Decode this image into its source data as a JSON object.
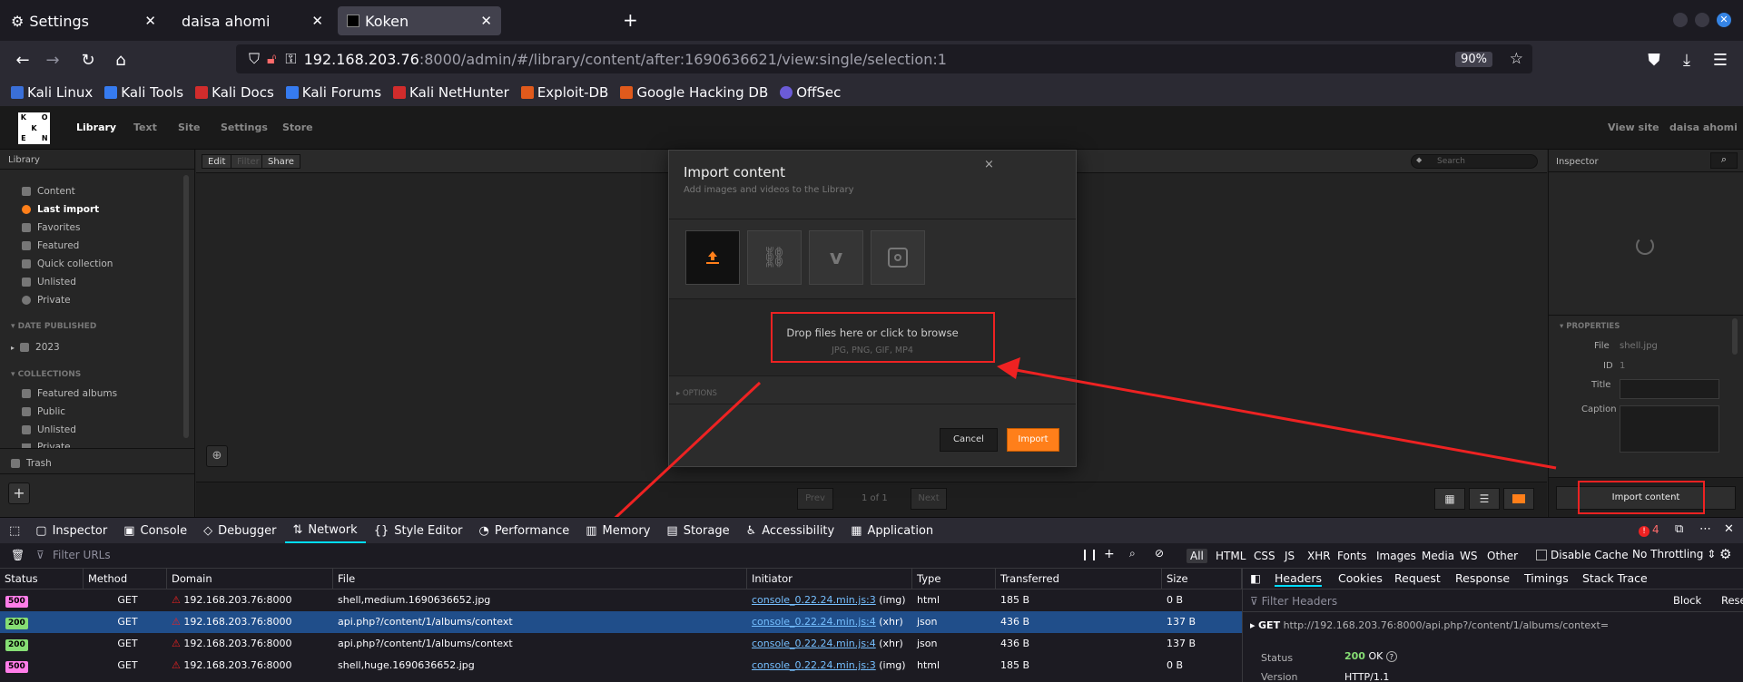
{
  "browser": {
    "tabs": [
      {
        "title": "Settings",
        "active": false
      },
      {
        "title": "daisa ahomi",
        "active": false
      },
      {
        "title": "Koken",
        "active": true
      }
    ],
    "url_host": "192.168.203.76",
    "url_rest": ":8000/admin/#/library/content/after:1690636621/view:single/selection:1",
    "zoom": "90%",
    "bookmarks": [
      {
        "label": "Kali Linux",
        "color": "#3a6fd8"
      },
      {
        "label": "Kali Tools",
        "color": "#367bf0"
      },
      {
        "label": "Kali Docs",
        "color": "#d12c2c"
      },
      {
        "label": "Kali Forums",
        "color": "#367bf0"
      },
      {
        "label": "Kali NetHunter",
        "color": "#d12c2c"
      },
      {
        "label": "Exploit-DB",
        "color": "#e05a1c"
      },
      {
        "label": "Google Hacking DB",
        "color": "#e05a1c"
      },
      {
        "label": "OffSec",
        "color": "#6b5bd6"
      }
    ]
  },
  "koken": {
    "logo_letters": [
      "K",
      "",
      "O",
      "",
      "K",
      "",
      "E",
      "",
      "N"
    ],
    "nav": [
      "Library",
      "Text",
      "Site",
      "Settings",
      "Store"
    ],
    "right_nav": [
      "View site",
      "daisa ahomi"
    ],
    "sidebar": {
      "title": "Library",
      "items": [
        {
          "label": "Content",
          "icon": "camera-icon"
        },
        {
          "label": "Last import",
          "icon": "clock-icon"
        },
        {
          "label": "Favorites",
          "icon": "heart-icon"
        },
        {
          "label": "Featured",
          "icon": "star-icon"
        },
        {
          "label": "Quick collection",
          "icon": "bolt-icon"
        },
        {
          "label": "Unlisted",
          "icon": "unlisted-icon"
        },
        {
          "label": "Private",
          "icon": "private-icon"
        }
      ],
      "date_heading": "DATE PUBLISHED",
      "year": "2023",
      "collections_heading": "COLLECTIONS",
      "collections": [
        "Featured albums",
        "Public",
        "Unlisted",
        "Private"
      ],
      "trash": "Trash"
    },
    "toolbar": {
      "edit": "Edit",
      "filter": "Filter",
      "share": "Share",
      "search_placeholder": "Search"
    },
    "inspector": {
      "title": "Inspector",
      "properties_heading": "PROPERTIES",
      "file_label": "File",
      "file_value": "shell.jpg",
      "id_label": "ID",
      "id_value": "1",
      "title_label": "Title",
      "caption_label": "Caption",
      "import_button": "Import content"
    },
    "pager": {
      "prev": "Prev",
      "info": "1 of 1",
      "next": "Next"
    },
    "modal": {
      "title": "Import content",
      "subtitle": "Add images and videos to the Library",
      "sources": [
        "upload-icon",
        "link-icon",
        "vimeo-icon",
        "instagram-icon"
      ],
      "drop_text": "Drop files here or click to browse",
      "formats": "JPG, PNG, GIF, MP4",
      "options": "OPTIONS",
      "cancel": "Cancel",
      "import": "Import",
      "close": "×"
    },
    "accent_color": "#ff7f1a"
  },
  "devtools": {
    "tabs": [
      "Inspector",
      "Console",
      "Debugger",
      "Network",
      "Style Editor",
      "Performance",
      "Memory",
      "Storage",
      "Accessibility",
      "Application"
    ],
    "active_tab": "Network",
    "error_count": "4",
    "filter_placeholder": "Filter URLs",
    "types": [
      "All",
      "HTML",
      "CSS",
      "JS",
      "XHR",
      "Fonts",
      "Images",
      "Media",
      "WS",
      "Other"
    ],
    "disable_cache": "Disable Cache",
    "throttling": "No Throttling",
    "columns": [
      "Status",
      "Method",
      "Domain",
      "File",
      "Initiator",
      "Type",
      "Transferred",
      "Size"
    ],
    "rows": [
      {
        "status": "500",
        "method": "GET",
        "domain": "192.168.203.76:8000",
        "file": "shell,medium.1690636652.jpg",
        "initiator": "console_0.22.24.min.js:3",
        "initiator_kind": " (img)",
        "type": "html",
        "transferred": "185 B",
        "size": "0 B",
        "selected": false
      },
      {
        "status": "200",
        "method": "GET",
        "domain": "192.168.203.76:8000",
        "file": "api.php?/content/1/albums/context",
        "initiator": "console_0.22.24.min.js:4",
        "initiator_kind": " (xhr)",
        "type": "json",
        "transferred": "436 B",
        "size": "137 B",
        "selected": true
      },
      {
        "status": "200",
        "method": "GET",
        "domain": "192.168.203.76:8000",
        "file": "api.php?/content/1/albums/context",
        "initiator": "console_0.22.24.min.js:4",
        "initiator_kind": " (xhr)",
        "type": "json",
        "transferred": "436 B",
        "size": "137 B",
        "selected": false
      },
      {
        "status": "500",
        "method": "GET",
        "domain": "192.168.203.76:8000",
        "file": "shell,huge.1690636652.jpg",
        "initiator": "console_0.22.24.min.js:3",
        "initiator_kind": " (img)",
        "type": "html",
        "transferred": "185 B",
        "size": "0 B",
        "selected": false
      }
    ],
    "panel": {
      "tabs": [
        "Headers",
        "Cookies",
        "Request",
        "Response",
        "Timings",
        "Stack Trace"
      ],
      "filter_placeholder": "Filter Headers",
      "block": "Block",
      "resend": "Resend",
      "request_method": "GET",
      "request_url_prefix": "http://192.168.203.76:8000/api.php?",
      "request_url_path": "/content/1/albums/context=",
      "status_label": "Status",
      "status_code": "200",
      "status_text": "OK",
      "version_label": "Version",
      "version_value": "HTTP/1.1"
    }
  }
}
